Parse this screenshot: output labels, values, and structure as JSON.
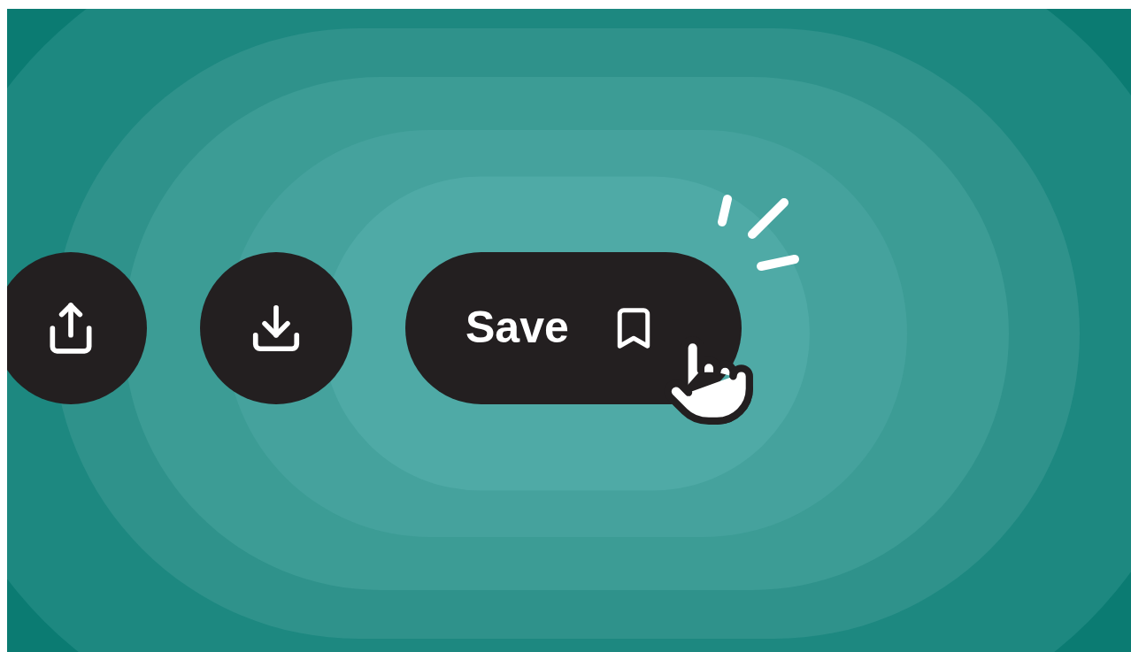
{
  "actions": [
    {
      "kind": "share"
    },
    {
      "kind": "download"
    }
  ],
  "save_button": {
    "label": "Save"
  }
}
